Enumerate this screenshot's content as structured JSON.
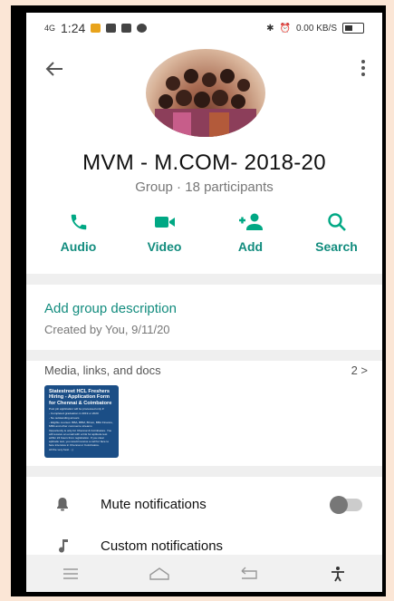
{
  "status_bar": {
    "signal": "4G",
    "time": "1:24",
    "right_text": "0.00 KB/S"
  },
  "group": {
    "name": "MVM - M.COM- 2018-20",
    "subtitle": "Group · 18 participants"
  },
  "actions": [
    {
      "label": "Audio",
      "icon": "phone-icon"
    },
    {
      "label": "Video",
      "icon": "video-camera-icon"
    },
    {
      "label": "Add",
      "icon": "add-person-icon"
    },
    {
      "label": "Search",
      "icon": "search-icon"
    }
  ],
  "description": {
    "link": "Add group description",
    "created": "Created by You, 9/11/20"
  },
  "media": {
    "heading": "Media, links, and docs",
    "count": "2 >",
    "thumbnail": {
      "title": "Statestreet HCL Freshers Hiring - Application Form for Chennai & Coimbatore",
      "lines": [
        "Post job application will be processed only if:",
        "- Completed graduation in 2019 or 2020",
        "- No outstanding arrears",
        "- Eligible courses: BBA, BBM, BCom, BBA Finance, MBA and other commerce streams",
        "Opportunity is only for Chennai & Coimbatore. You will receive an email with a link for aptitude test within 24 hours from registration. If you clear aptitude test, you would receive a call for face to face interview in Chennai or Coimbatore.",
        "All the very best. :-)"
      ]
    }
  },
  "settings": [
    {
      "label": "Mute notifications",
      "icon": "bell-icon"
    },
    {
      "label": "Custom notifications",
      "icon": "music-note-icon"
    }
  ],
  "colors": {
    "accent": "#128c7e",
    "icon_green": "#00a884",
    "background": "#fbe6d6"
  }
}
